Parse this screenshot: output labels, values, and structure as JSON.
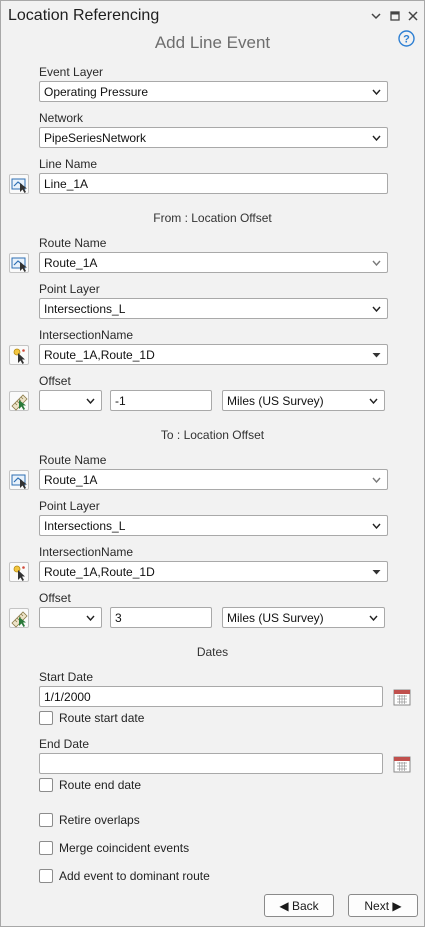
{
  "pane": {
    "title": "Location Referencing",
    "subtitle": "Add Line Event"
  },
  "event_layer": {
    "label": "Event Layer",
    "value": "Operating Pressure"
  },
  "network": {
    "label": "Network",
    "value": "PipeSeriesNetwork"
  },
  "line_name": {
    "label": "Line Name",
    "value": "Line_1A"
  },
  "from": {
    "section": "From : Location Offset",
    "route_label": "Route Name",
    "route_value": "Route_1A",
    "point_layer_label": "Point Layer",
    "point_layer_value": "Intersections_L",
    "intersection_label": "IntersectionName",
    "intersection_value": "Route_1A,Route_1D",
    "offset_label": "Offset",
    "offset_direction": "",
    "offset_value": "-1",
    "offset_units": "Miles (US Survey)"
  },
  "to": {
    "section": "To : Location Offset",
    "route_label": "Route Name",
    "route_value": "Route_1A",
    "point_layer_label": "Point Layer",
    "point_layer_value": "Intersections_L",
    "intersection_label": "IntersectionName",
    "intersection_value": "Route_1A,Route_1D",
    "offset_label": "Offset",
    "offset_direction": "",
    "offset_value": "3",
    "offset_units": "Miles (US Survey)"
  },
  "dates": {
    "section": "Dates",
    "start_label": "Start Date",
    "start_value": "1/1/2000",
    "route_start_label": "Route start date",
    "end_label": "End Date",
    "end_value": "",
    "route_end_label": "Route end date"
  },
  "options": {
    "retire_overlaps": "Retire overlaps",
    "merge_coincident": "Merge coincident events",
    "add_dominant": "Add event to dominant route"
  },
  "buttons": {
    "back": "◀ Back",
    "next": "Next ▶"
  },
  "colors": {
    "accent": "#2d7fd3",
    "border": "#a9a9a9",
    "panel": "#f2f2f2"
  }
}
